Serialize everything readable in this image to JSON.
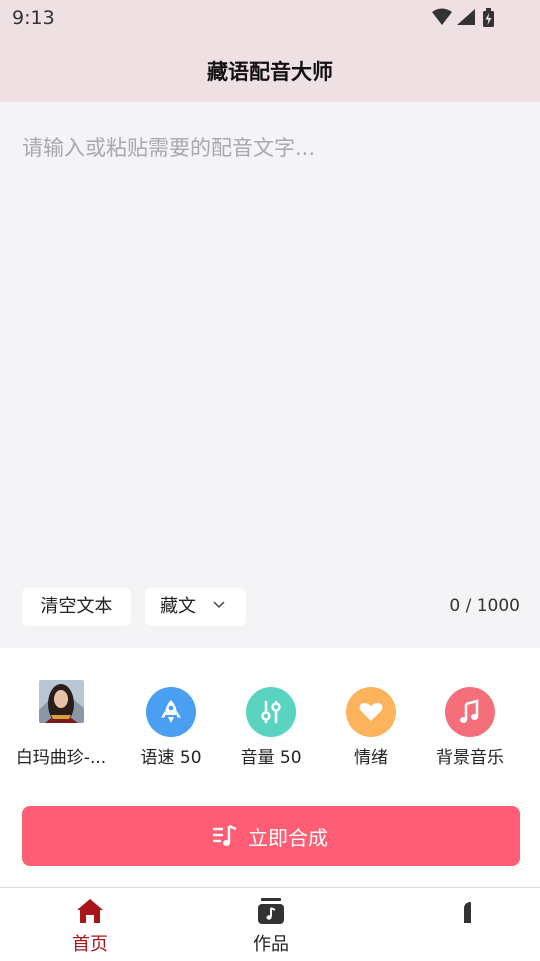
{
  "status_bar": {
    "time": "9:13",
    "icons": [
      "wifi-icon",
      "cell-signal-icon",
      "battery-charging-icon"
    ]
  },
  "app_bar": {
    "title": "藏语配音大师"
  },
  "editor": {
    "placeholder": "请输入或粘贴需要的配音文字...",
    "value": "",
    "clear_label": "清空文本",
    "language": "藏文",
    "char_count": "0 / 1000"
  },
  "options": [
    {
      "label": "白玛曲珍-...",
      "icon": "voice-avatar"
    },
    {
      "label": "语速 50",
      "icon": "rocket-icon",
      "color": "#4a9ff2"
    },
    {
      "label": "音量 50",
      "icon": "equalizer-icon",
      "color": "#5bd3c1"
    },
    {
      "label": "情绪",
      "icon": "heart-icon",
      "color": "#fbb45c"
    },
    {
      "label": "背景音乐",
      "icon": "music-note-icon",
      "color": "#f46f79"
    }
  ],
  "synthesize": {
    "label": "立即合成",
    "icon": "playlist-music-icon"
  },
  "tabs": [
    {
      "label": "首页",
      "icon": "home-icon",
      "active": true
    },
    {
      "label": "作品",
      "icon": "works-icon",
      "active": false
    },
    {
      "label": "",
      "icon": "profile-icon",
      "active": false
    }
  ],
  "colors": {
    "accent": "#fe5d73",
    "tab_active": "#a6161a",
    "header_bg": "#efe0e3",
    "editor_bg": "#f4f4f7"
  }
}
